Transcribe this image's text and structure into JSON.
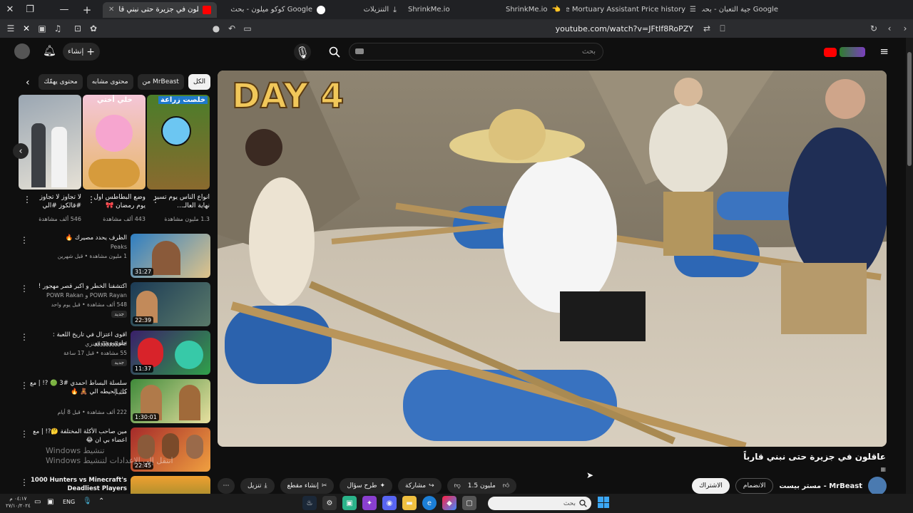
{
  "browser": {
    "tabs": [
      {
        "label": "عاقلون في جزيرة حتى نبني قا…",
        "active": true
      },
      {
        "label": "كوكو ميلون - بحث Google"
      },
      {
        "label": "التنزيلات"
      },
      {
        "label": "ShrinkMe.io"
      },
      {
        "label": "ShrinkMe.io"
      },
      {
        "label": "The Mortuary Assistant Price history"
      },
      {
        "label": "جية التعبان - بحث Google"
      }
    ],
    "url": "youtube.com/watch?v=JFtIf8RoPZY",
    "new_tab": "+"
  },
  "header": {
    "create_label": "إنشاء",
    "search_placeholder": "بحث"
  },
  "chips": [
    {
      "label": "الكل",
      "selected": true
    },
    {
      "label": "من MrBeast"
    },
    {
      "label": "محتوى مشابه"
    },
    {
      "label": "محتوى يهمّك"
    }
  ],
  "shorts": [
    {
      "title": "لا تجاوز لا تجاوز #قالكوز #الي",
      "views": "546 ألف مشاهدة",
      "overlay": ""
    },
    {
      "title": "وضع البطاطس اول يوم رمضان 🎀",
      "views": "443 ألف مشاهدة",
      "overlay": "خلي أختي"
    },
    {
      "title": "انواع الناس يوم تسير نهاية العالـ...",
      "views": "1.3 مليون مشاهدة",
      "overlay": "خلصت زراعة"
    }
  ],
  "recommendations": [
    {
      "title": "الظرف يحدد مصيرك 🔥",
      "channel": "Peaks",
      "meta": "1 مليون مشاهدة • قبل شهرين",
      "duration": "31:27",
      "badge": ""
    },
    {
      "title": "اكتشفنا الخطر و اكبر قصر مهجور !",
      "channel": "POWR Rayan و POWR Rakan",
      "meta": "548 ألف مشاهدة • قبل يوم واحد",
      "duration": "22:39",
      "badge": "جديد"
    },
    {
      "title": "اقوى اعتزال في تاريخ اللعبة : جلووووووووو",
      "channel": "The Real العنزي",
      "meta": "55 مشاهدة • قبل 17 ساعة",
      "duration": "11:37",
      "badge": "جديد"
    },
    {
      "title": "سلسلة البساط احمدي #3 🟢 ?! | مع كل الحيطه الي 🧸 🔥",
      "channel": "سليم",
      "meta": "222 ألف مشاهدة • قبل 8 أيام",
      "duration": "1:30:01",
      "badge": ""
    },
    {
      "title": "مين صاحب الأكلة المختلفة 🤔?! | مع اعضاء بي ان 😂",
      "channel": "",
      "meta": "",
      "duration": "22:45",
      "badge": ""
    },
    {
      "title": "1000 Hunters vs Minecraft's Deadliest Players",
      "channel": "",
      "meta": "",
      "duration": "",
      "badge": ""
    }
  ],
  "video": {
    "title": "عاقلون في جزيرة حتى نبني قارباً",
    "overlay_text": "DAY 4",
    "channel": "MrBeast - مستر بيست",
    "subs": "مليون",
    "like_count": "1.5 مليون",
    "subscribe_label": "الاشتراك",
    "join_label": "الانضمام",
    "share_label": "مشاركة",
    "ask_label": "طرح سؤال",
    "clip_label": "إنشاء مقطع",
    "download_label": "تنزيل"
  },
  "watermark": {
    "line1": "Windows تنشيط",
    "line2": "Windows انتقل إلى الإعدادات لتنشيط"
  },
  "taskbar": {
    "search_placeholder": "بحث",
    "lang": "ENG",
    "time": "٠٤:١٧ م",
    "date": "٢٧/١٠/٢٠٢٤"
  },
  "colors": {
    "accent": "#ff0000",
    "bg": "#0f0f0f",
    "chip": "#272727"
  }
}
